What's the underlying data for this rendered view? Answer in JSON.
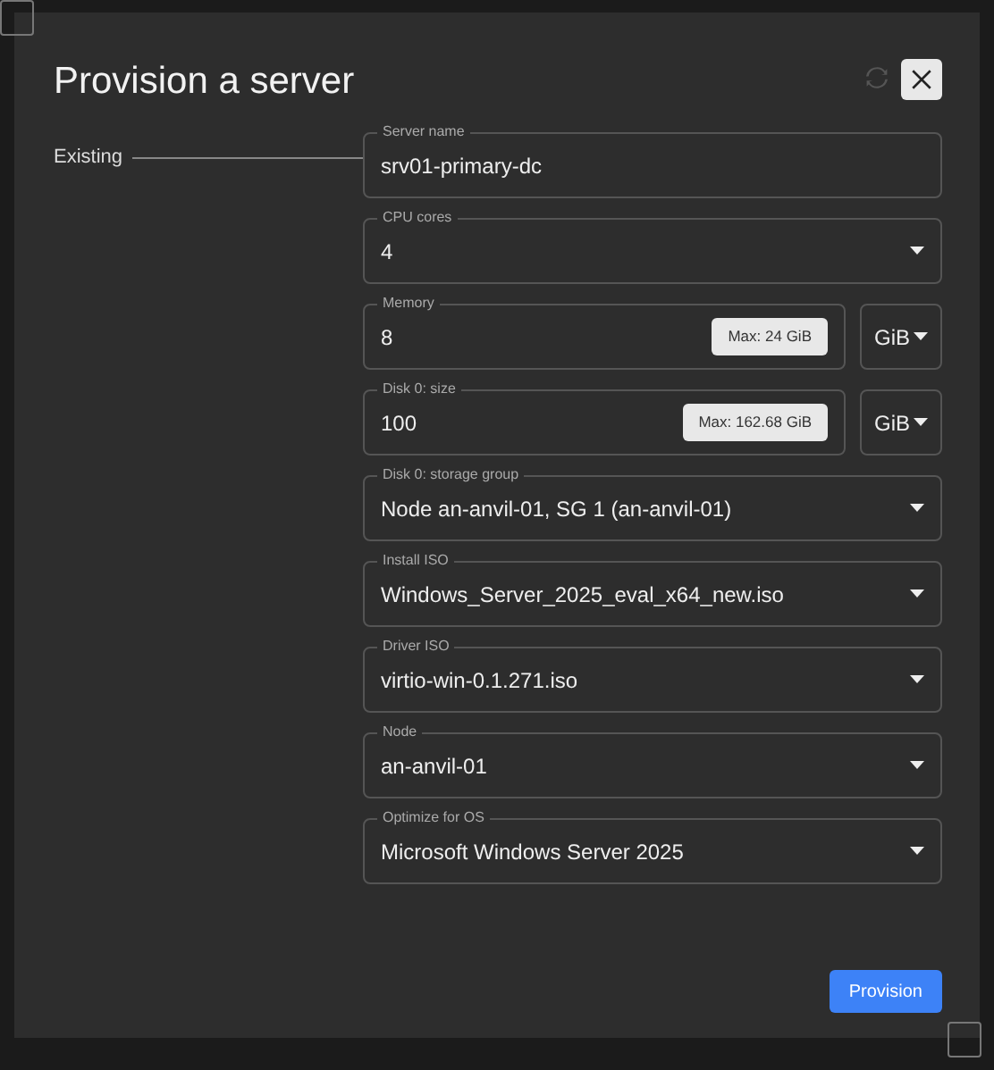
{
  "dialog": {
    "title": "Provision a server",
    "section_label": "Existing"
  },
  "fields": [
    {
      "kind": "text",
      "label": "Server name",
      "value": "srv01-primary-dc"
    },
    {
      "kind": "select",
      "label": "CPU cores",
      "value": "4"
    },
    {
      "kind": "amount",
      "label": "Memory",
      "value": "8",
      "max_button": "Max: 24 GiB",
      "unit": "GiB"
    },
    {
      "kind": "amount",
      "label": "Disk 0: size",
      "value": "100",
      "max_button": "Max: 162.68 GiB",
      "unit": "GiB"
    },
    {
      "kind": "select",
      "label": "Disk 0: storage group",
      "value": "Node an-anvil-01, SG 1 (an-anvil-01)"
    },
    {
      "kind": "select",
      "label": "Install ISO",
      "value": "Windows_Server_2025_eval_x64_new.iso"
    },
    {
      "kind": "select",
      "label": "Driver ISO",
      "value": "virtio-win-0.1.271.iso"
    },
    {
      "kind": "select",
      "label": "Node",
      "value": "an-anvil-01"
    },
    {
      "kind": "select",
      "label": "Optimize for OS",
      "value": "Microsoft Windows Server 2025"
    }
  ],
  "submit": "Provision"
}
